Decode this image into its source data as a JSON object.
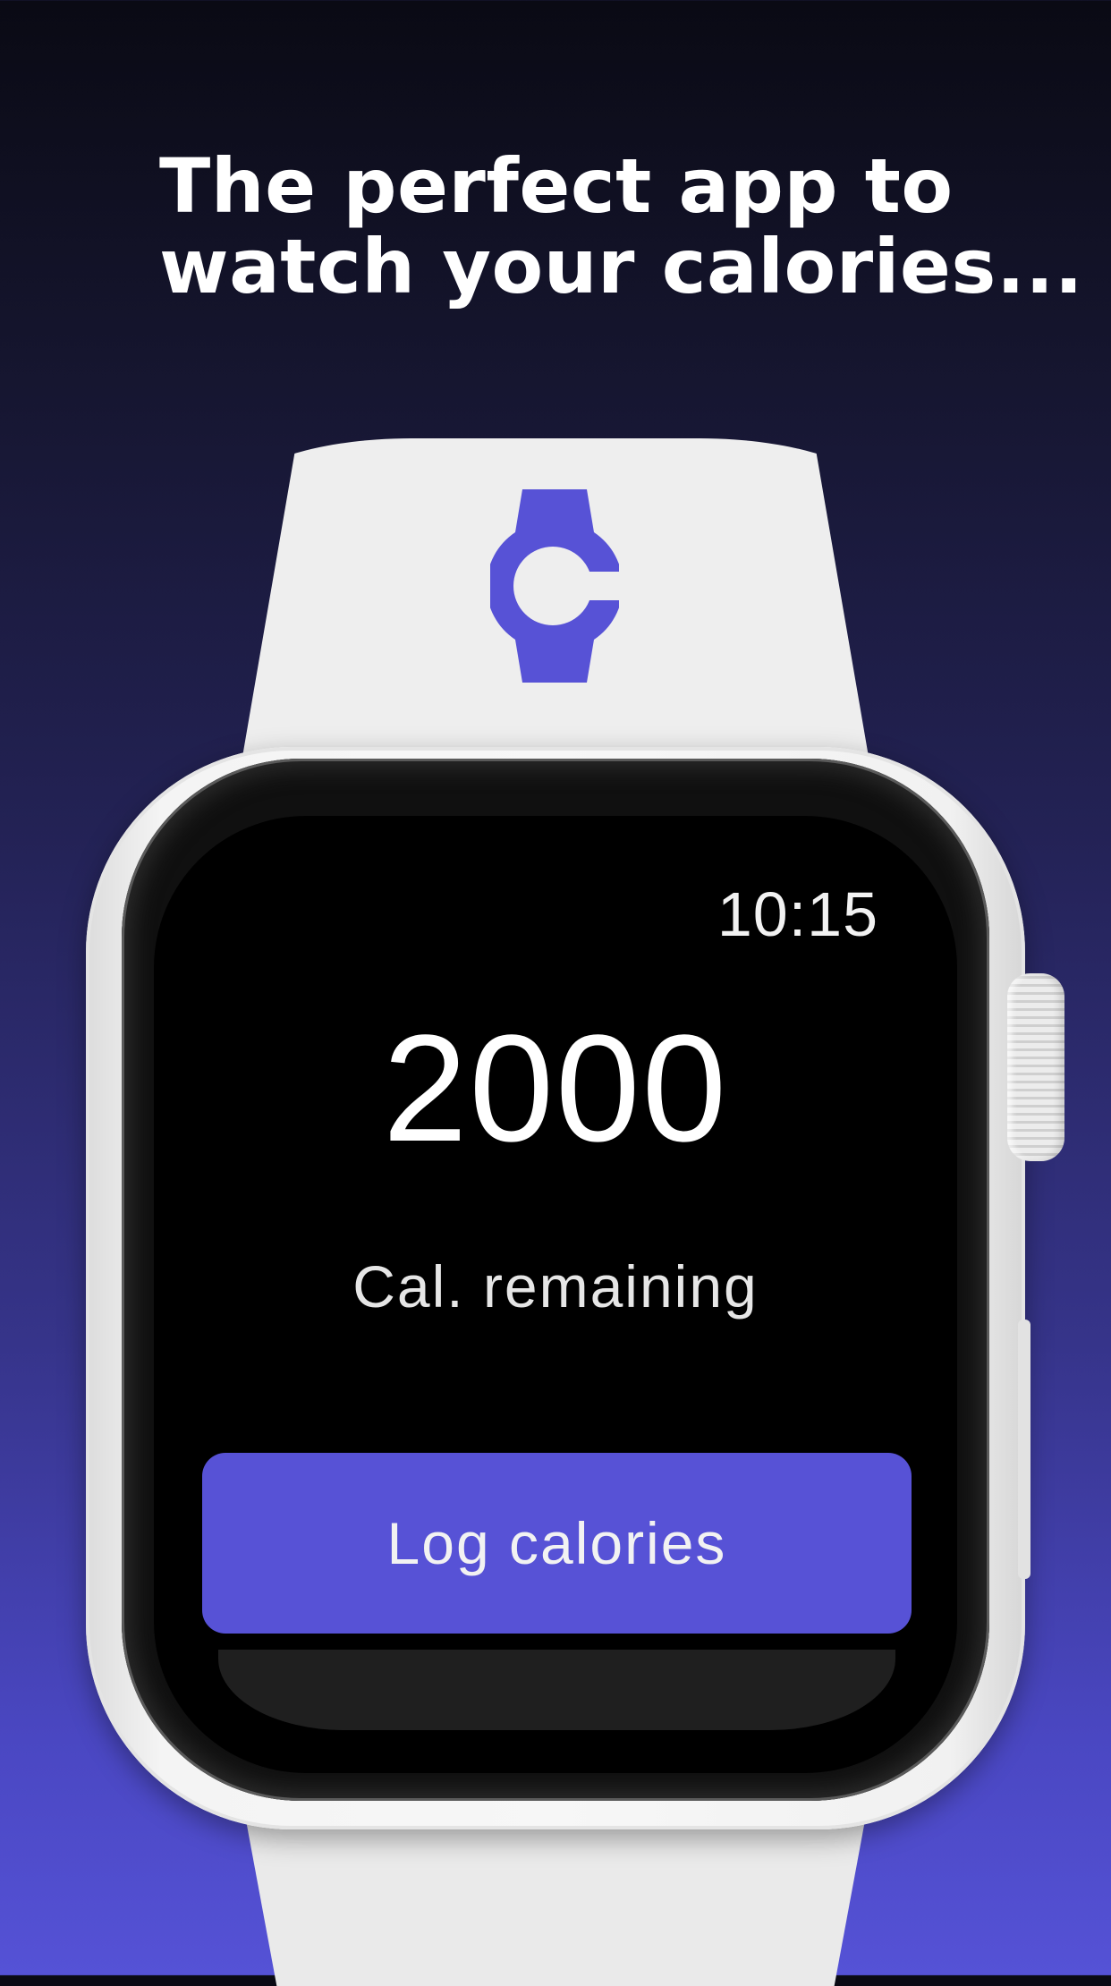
{
  "headline": {
    "line1": "The perfect app to",
    "line2": "watch your calories..."
  },
  "app_logo": {
    "icon": "watch-calorie-logo-icon",
    "color": "#5752d6"
  },
  "watch_screen": {
    "time": "10:15",
    "calories_value": "2000",
    "calories_label": "Cal. remaining",
    "log_button_label": "Log calories",
    "button_color": "#5752d6"
  },
  "colors": {
    "background_top": "#0a0a14",
    "background_bottom": "#5552d6",
    "band": "#eeeeee",
    "accent": "#5752d6"
  }
}
